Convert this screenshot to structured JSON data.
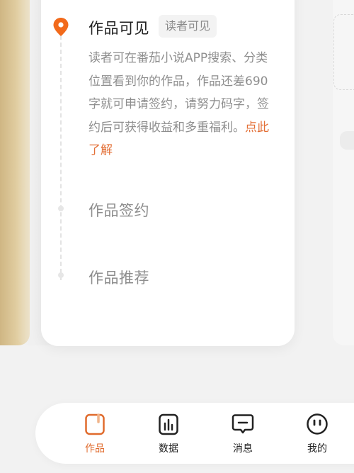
{
  "timeline": {
    "steps": [
      {
        "title": "作品可见",
        "badge": "读者可见",
        "description": "读者可在番茄小说APP搜索、分类位置看到你的作品，作品还差690字就可申请签约，请努力码字，签约后可获得收益和多重福利。",
        "link_text": "点此了解"
      },
      {
        "title": "作品签约"
      },
      {
        "title": "作品推荐"
      }
    ]
  },
  "bottom_nav": {
    "items": [
      {
        "label": "作品",
        "icon": "works-icon",
        "active": true
      },
      {
        "label": "数据",
        "icon": "data-chart-icon",
        "active": false
      },
      {
        "label": "消息",
        "icon": "message-icon",
        "active": false
      },
      {
        "label": "我的",
        "icon": "profile-face-icon",
        "active": false
      }
    ]
  },
  "colors": {
    "accent": "#e06b2d",
    "link": "#e36f36",
    "gold_edge": "#d8c290",
    "muted_text": "#8e8e8e"
  }
}
